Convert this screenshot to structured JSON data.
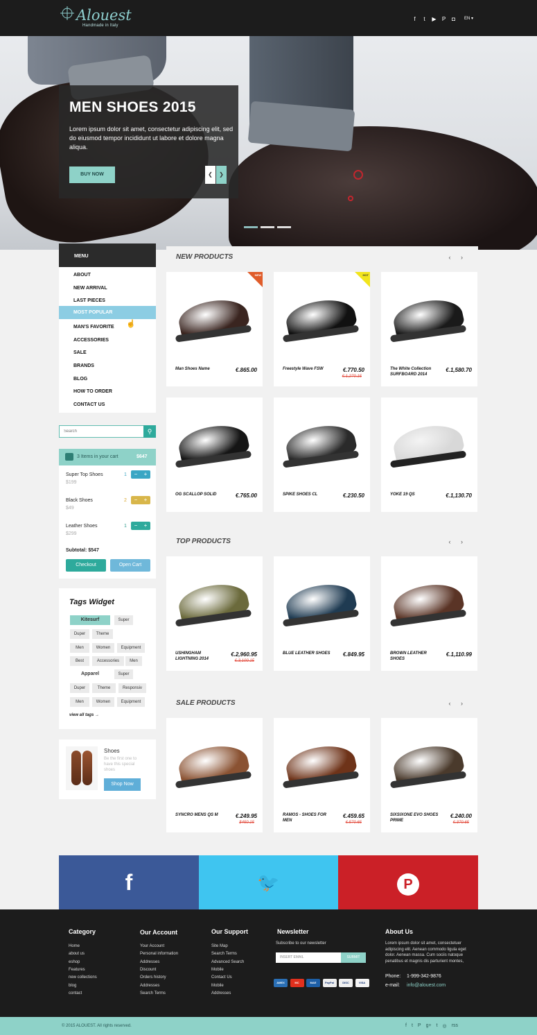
{
  "brand": {
    "name": "Alouest",
    "tagline": "Handmade in Italy"
  },
  "header": {
    "social_icons": [
      "facebook-icon",
      "twitter-icon",
      "youtube-icon",
      "pinterest-icon",
      "instagram-icon"
    ],
    "lang": "EN ▾"
  },
  "hero": {
    "title": "MEN SHOES 2015",
    "text": "Lorem ipsum dolor sit amet, consectetur adipiscing elit, sed do eiusmod tempor incididunt ut labore et dolore magna aliqua.",
    "button": "BUY NOW",
    "prev": "❮",
    "next": "❯"
  },
  "menu": {
    "title": "MENU",
    "items": [
      "ABOUT",
      "NEW ARRIVAL",
      "LAST PIECES",
      "MOST POPULAR",
      "MAN'S FAVORITE",
      "ACCESSORIES",
      "SALE",
      "BRANDS",
      "BLOG",
      "HOW TO ORDER",
      "CONTACT US"
    ],
    "active_index": 3
  },
  "search": {
    "placeholder": "Search",
    "icon": "⚲"
  },
  "cart": {
    "summary": "3 Items in your cart",
    "total": "$647",
    "items": [
      {
        "name": "Super Top Shoes",
        "price": "$199",
        "qty": "1",
        "color": "#3aa6c4",
        "qty_color": "#3aa6c4"
      },
      {
        "name": "Black Shoes",
        "price": "$49",
        "qty": "2",
        "color": "#d8b64a",
        "qty_color": "#d8a52a"
      },
      {
        "name": "Leather Shoes",
        "price": "$299",
        "qty": "1",
        "color": "#2eaa9c",
        "qty_color": "#2e9a8e"
      }
    ],
    "subtotal": "Subtotal: $547",
    "checkout": "Checkout",
    "open": "Open Cart"
  },
  "tags": {
    "title": "Tags Widget",
    "items": [
      {
        "label": "Kitesurf",
        "style": "hl"
      },
      {
        "label": "Super",
        "style": ""
      },
      {
        "label": "Duper",
        "style": ""
      },
      {
        "label": "Theme",
        "style": ""
      },
      {
        "label": "Men",
        "style": ""
      },
      {
        "label": "Women",
        "style": ""
      },
      {
        "label": "Equipment",
        "style": ""
      },
      {
        "label": "Best",
        "style": ""
      },
      {
        "label": "Accessories",
        "style": ""
      },
      {
        "label": "Men",
        "style": ""
      },
      {
        "label": "Apparel",
        "style": "bold"
      },
      {
        "label": "Super",
        "style": ""
      },
      {
        "label": "Duper",
        "style": ""
      },
      {
        "label": "Theme",
        "style": ""
      },
      {
        "label": "Responsiv",
        "style": ""
      },
      {
        "label": "Men",
        "style": ""
      },
      {
        "label": "Women",
        "style": ""
      },
      {
        "label": "Equipment",
        "style": ""
      }
    ],
    "view_all": "view all tags →"
  },
  "promo": {
    "title": "Shoes",
    "text": "Be the first one to have this special shoes",
    "button": "Shop Now"
  },
  "sections": [
    {
      "title": "NEW PRODUCTS",
      "arrows": "‹ ›",
      "products": [
        {
          "name": "Man Shoes Name",
          "price": "€.865.00",
          "old": "",
          "ribbon": "NEW",
          "shoe": "#3a2520"
        },
        {
          "name": "Freestyle Wave FSW",
          "price": "€.770.50",
          "old": "€.1,270.15",
          "ribbon": "HOT",
          "shoe": "#111111"
        },
        {
          "name": "The White Collection SURFBOARD 2014",
          "price": "€.1,580.70",
          "old": "",
          "ribbon": "",
          "shoe": "#1a1a1a"
        },
        {
          "name": "OG SCALLOP SOLID",
          "price": "€.765.00",
          "old": "",
          "ribbon": "",
          "shoe": "#151515"
        },
        {
          "name": "SPIKE SHOES CL",
          "price": "€.230.50",
          "old": "",
          "ribbon": "",
          "shoe": "#2a2a2a"
        },
        {
          "name": "YOKE 19 QS",
          "price": "€.1,130.70",
          "old": "",
          "ribbon": "",
          "shoe": "#d8d8d8"
        }
      ]
    },
    {
      "title": "TOP PRODUCTS",
      "arrows": "‹ ›",
      "products": [
        {
          "name": "USHINGHAM LIGHTNING 2014",
          "price": "€.2,960.95",
          "old": "€.3,100.15",
          "ribbon": "",
          "shoe": "#6b6a3c"
        },
        {
          "name": "BLUE LEATHER SHOES",
          "price": "€.849.95",
          "old": "",
          "ribbon": "",
          "shoe": "#1f3b52"
        },
        {
          "name": "BROWN LEATHER SHOES",
          "price": "€.1,110.99",
          "old": "",
          "ribbon": "",
          "shoe": "#5a3426"
        }
      ]
    },
    {
      "title": "SALE PRODUCTS",
      "arrows": "‹ ›",
      "products": [
        {
          "name": "SYNCRO MENS QS M",
          "price": "€.249.95",
          "old": "$450.15",
          "ribbon": "",
          "shoe": "#8a5232"
        },
        {
          "name": "RAMOS - SHOES FOR MEN",
          "price": "€.459.65",
          "old": "€.570.65",
          "ribbon": "",
          "shoe": "#6e3319"
        },
        {
          "name": "SIXSIXONE EVO SHOES PRIME",
          "price": "€.240.00",
          "old": "€.370.65",
          "ribbon": "",
          "shoe": "#4a3a2c"
        }
      ]
    }
  ],
  "social_bar": [
    {
      "icon": "facebook-icon",
      "glyph": "f",
      "color": "#3b5998"
    },
    {
      "icon": "twitter-icon",
      "glyph": "🐦",
      "color": "#3fc5f0"
    },
    {
      "icon": "pinterest-icon",
      "glyph": "P",
      "color": "#cb2027"
    }
  ],
  "footer": {
    "category": {
      "title": "Category",
      "links": [
        "Home",
        "about us",
        "eshop",
        "Features",
        "new collections",
        "blog",
        "contact"
      ]
    },
    "account": {
      "title": "Our Account",
      "links": [
        "Your Account",
        "Personal information",
        "Addresses",
        "Discount",
        "Orders history",
        "Addresses",
        "Search Terms"
      ]
    },
    "support": {
      "title": "Our Support",
      "links": [
        "Site Map",
        "Search Terms",
        "Advanced Search",
        "Mobile",
        "Contact Us",
        "Mobile",
        "Addresses"
      ]
    },
    "newsletter": {
      "title": "Newsletter",
      "text": "Subscribe to our newsletter",
      "placeholder": "INSERT EMAIL",
      "button": "SUBMIT",
      "cards": [
        {
          "label": "AMEX",
          "color": "#2a6fb5"
        },
        {
          "label": "MC",
          "color": "#e0301e"
        },
        {
          "label": "MAE",
          "color": "#1d5fa7"
        },
        {
          "label": "PayPal",
          "color": "#eeeeee"
        },
        {
          "label": "DISC",
          "color": "#f0f0f0"
        },
        {
          "label": "VISA",
          "color": "#f5f5f5"
        }
      ]
    },
    "about": {
      "title": "About Us",
      "text": "Lorem ipsum dolor sit amet, consectetuer adipiscing elit. Aenean commodo ligula eget dolor. Aenean massa. Cum sociis natoque penatibus et magnis dis parturient montes,",
      "phone_label": "Phone:",
      "phone": "1-999-342-9876",
      "email_label": "e-mail:",
      "email": "info@alouest.com"
    },
    "copyright": "© 2015 ALOUEST. All rights reserved.",
    "social": [
      "f",
      "t",
      "P",
      "g+",
      "t",
      "◎",
      "rss"
    ]
  }
}
